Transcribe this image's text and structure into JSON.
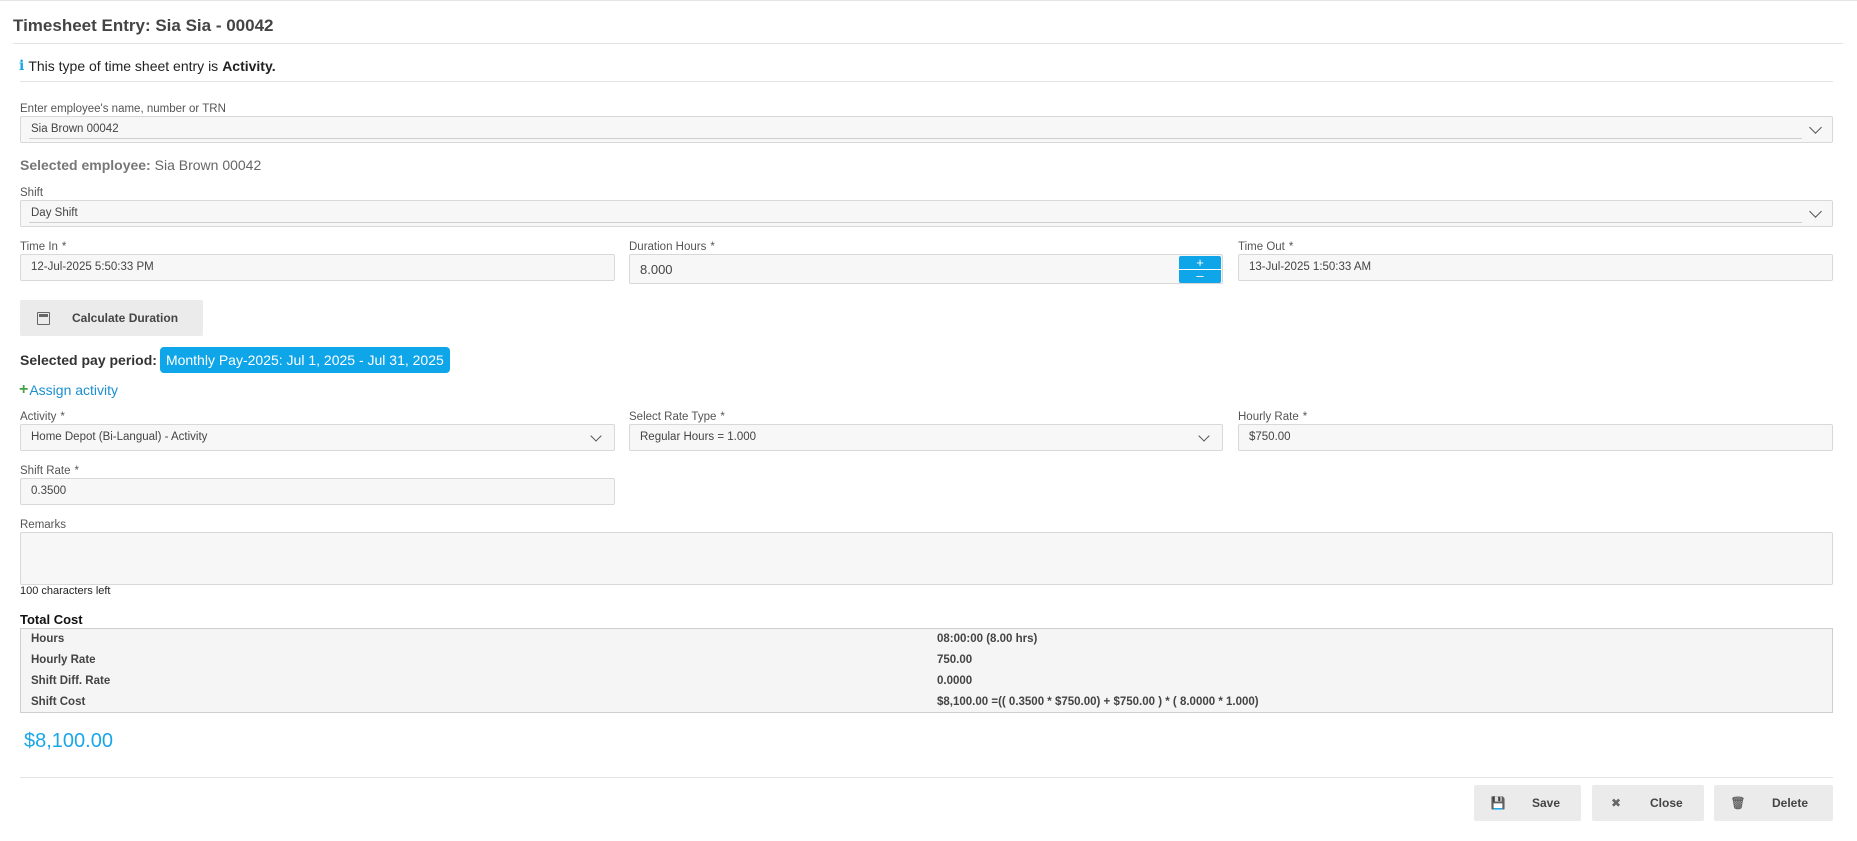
{
  "page_title": "Timesheet Entry: Sia Sia - 00042",
  "info": {
    "prefix": "This type of time sheet entry is",
    "type": "Activity."
  },
  "employee": {
    "label": "Enter employee's name, number or TRN",
    "value": "Sia Brown 00042",
    "selected_label": "Selected employee:",
    "selected_value": "Sia Brown 00042"
  },
  "shift": {
    "label": "Shift",
    "value": "Day Shift"
  },
  "time_in": {
    "label": "Time In",
    "value": "12-Jul-2025 5:50:33 PM"
  },
  "duration": {
    "label": "Duration Hours",
    "value": "8.000",
    "plus": "+",
    "minus": "–"
  },
  "time_out": {
    "label": "Time Out",
    "value": "13-Jul-2025 1:50:33 AM"
  },
  "required_mark": "*",
  "calculate_button": "Calculate Duration",
  "pay_period": {
    "label": "Selected pay period:",
    "value": "Monthly Pay-2025: Jul 1, 2025 - Jul 31, 2025"
  },
  "assign_activity": "Assign activity",
  "activity": {
    "label": "Activity",
    "value": "Home Depot (Bi-Langual) - Activity"
  },
  "rate_type": {
    "label": "Select Rate Type",
    "value": "Regular Hours = 1.000"
  },
  "hourly_rate": {
    "label": "Hourly Rate",
    "value": "$750.00"
  },
  "shift_rate": {
    "label": "Shift Rate",
    "value": "0.3500"
  },
  "remarks": {
    "label": "Remarks",
    "chars_left": "100 characters left"
  },
  "total_cost": {
    "title": "Total Cost",
    "rows": [
      {
        "label": "Hours",
        "value": "08:00:00 (8.00 hrs)"
      },
      {
        "label": "Hourly Rate",
        "value": "750.00"
      },
      {
        "label": "Shift Diff. Rate",
        "value": "0.0000"
      },
      {
        "label": "Shift Cost",
        "value": "$8,100.00 =(( 0.3500 * $750.00) + $750.00 ) * ( 8.0000 * 1.000)"
      }
    ],
    "amount": "$8,100.00"
  },
  "buttons": {
    "save": "Save",
    "close": "Close",
    "delete": "Delete"
  },
  "icons": {
    "info": "info-icon",
    "calculator": "calculator-icon",
    "plus": "plus-icon",
    "save": "floppy-disk-icon",
    "close": "x-icon",
    "delete": "trash-icon",
    "chevron": "chevron-down-icon"
  },
  "colors": {
    "accent": "#0ea5e9",
    "link": "#1a8fd1",
    "plus_green": "#45a14a"
  }
}
